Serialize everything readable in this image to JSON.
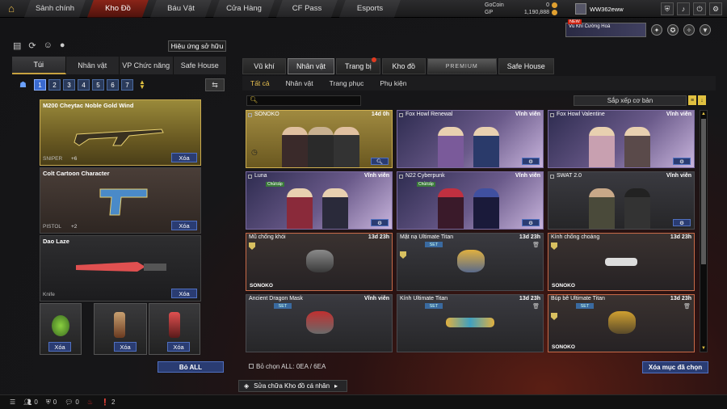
{
  "nav": {
    "tabs": [
      "Sảnh chính",
      "Kho Đồ",
      "Báu Vật",
      "Cửa Hàng",
      "CF Pass",
      "Esports"
    ],
    "active": 1
  },
  "currency": {
    "gocoin_label": "GoCoin",
    "gocoin_value": "0",
    "gp_label": "GP",
    "gp_value": "1,190,888"
  },
  "user": {
    "name": "WW362eww"
  },
  "badge": {
    "new": "NEW",
    "text": "Vũ Khí Cường Hoá"
  },
  "left": {
    "fit_button": "Hiệu ứng sở hữu",
    "tabs": [
      "Túi",
      "Nhân vật",
      "VP Chức năng",
      "Safe House"
    ],
    "pages": [
      "1",
      "2",
      "3",
      "4",
      "5",
      "6",
      "7"
    ],
    "items": [
      {
        "name": "M200 Cheytac Noble Gold Wind",
        "category": "SNIPER",
        "count": "+6",
        "action": "Xóa"
      },
      {
        "name": "Colt Cartoon Character",
        "category": "PISTOL",
        "count": "+2",
        "action": "Xóa"
      },
      {
        "name": "Dao Laze",
        "category": "Knife",
        "action": "Xóa"
      }
    ],
    "grenades": [
      {
        "action": "Xóa"
      },
      {
        "action": "Xóa"
      },
      {
        "action": "Xóa"
      }
    ],
    "bo_all": "Bỏ ALL"
  },
  "right": {
    "tabs": [
      "Vũ khí",
      "Nhân vật",
      "Trang bị",
      "Kho đồ",
      "PREMIUM",
      "Safe House"
    ],
    "subtabs": [
      "Tất cả",
      "Nhân vật",
      "Trang phục",
      "Phụ kiện"
    ],
    "sort": "Sắp xếp cơ bản",
    "cards": [
      {
        "name": "SONOKO",
        "duration": "14d 0h"
      },
      {
        "name": "Fox Howl Renewal",
        "duration": "Vĩnh viễn"
      },
      {
        "name": "Fox Howl Valentine",
        "duration": "Vĩnh viễn"
      },
      {
        "name": "Luna",
        "duration": "Vĩnh viễn",
        "rarity": "Chủ/cấp"
      },
      {
        "name": "N22 Cyberpunk",
        "duration": "Vĩnh viễn",
        "rarity": "Chủ/cấp"
      },
      {
        "name": "SWAT 2.0",
        "duration": "Vĩnh viễn"
      },
      {
        "name": "Mũ chống khói",
        "duration": "13d 23h",
        "owner": "SONOKO"
      },
      {
        "name": "Mặt nạ Ultimate Titan",
        "duration": "13d 23h",
        "set": "SET"
      },
      {
        "name": "Kính chống choáng",
        "duration": "13d 23h",
        "owner": "SONOKO"
      },
      {
        "name": "Ancient Dragon Mask",
        "duration": "Vĩnh viễn",
        "set": "SET"
      },
      {
        "name": "Kính Ultimate Titan",
        "duration": "13d 23h",
        "set": "SET"
      },
      {
        "name": "Búp bê Ultimate Titan",
        "duration": "13d 23h",
        "set": "SET",
        "owner": "SONOKO"
      }
    ],
    "bo_chon": "Bỏ chọn ALL: 0EA / 6EA",
    "xoa_muc": "Xóa mục đã chọn",
    "sua_chua": "Sửa chữa Kho đồ cá nhân"
  },
  "bottom": {
    "v1": "0",
    "v2": "0",
    "v3": "0",
    "v4": "2"
  }
}
